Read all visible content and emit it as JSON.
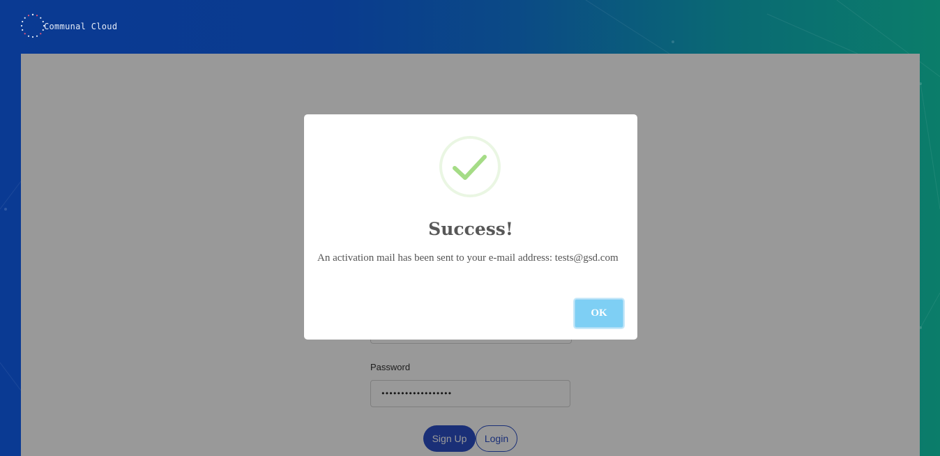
{
  "app": {
    "brand_name": "Communal Cloud",
    "logo_icon": "dotted-circle-logo-icon"
  },
  "form": {
    "password_label": "Password",
    "password_value": "••••••••••••••••••",
    "signup_label": "Sign Up",
    "login_label": "Login"
  },
  "modal": {
    "icon": "success-checkmark-icon",
    "title": "Success!",
    "message": "An activation mail has been sent to your e-mail address: tests@gsd.com",
    "ok_label": "OK"
  },
  "colors": {
    "background_left": "#0a3a93",
    "background_right": "#0b7d6a",
    "primary_button": "#2c4fc7",
    "ok_button": "#7ecff4",
    "checkmark": "#a5dc86"
  }
}
